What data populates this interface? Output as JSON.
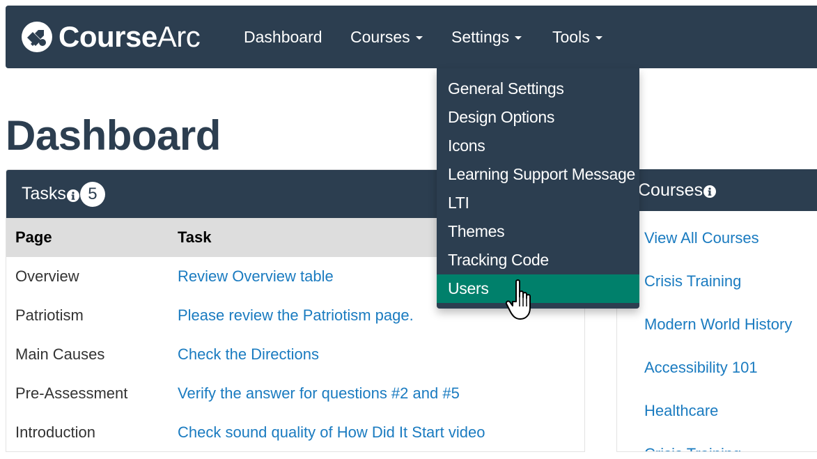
{
  "brand": {
    "bold": "Course",
    "light": "Arc"
  },
  "nav": {
    "dashboard": "Dashboard",
    "courses": "Courses",
    "settings": "Settings",
    "tools": "Tools"
  },
  "settings_menu": {
    "items": [
      {
        "label": "General Settings",
        "active": false
      },
      {
        "label": "Design Options",
        "active": false
      },
      {
        "label": "Icons",
        "active": false
      },
      {
        "label": "Learning Support Message",
        "active": false
      },
      {
        "label": "LTI",
        "active": false
      },
      {
        "label": "Themes",
        "active": false
      },
      {
        "label": "Tracking Code",
        "active": false
      },
      {
        "label": "Users",
        "active": true
      }
    ]
  },
  "page_title": "Dashboard",
  "tasks": {
    "title": "Tasks",
    "count": "5",
    "columns": [
      "Page",
      "Task"
    ],
    "rows": [
      {
        "page": "Overview",
        "task": "Review Overview table"
      },
      {
        "page": "Patriotism",
        "task": "Please review the Patriotism page."
      },
      {
        "page": "Main Causes",
        "task": "Check the Directions"
      },
      {
        "page": "Pre-Assessment",
        "task": "Verify the answer for questions #2 and #5"
      },
      {
        "page": "Introduction",
        "task": "Check sound quality of How Did It Start video"
      }
    ]
  },
  "courses": {
    "title": "Courses",
    "links": [
      "View All Courses",
      "Crisis Training",
      "Modern World History",
      "Accessibility 101",
      "Healthcare",
      "Crisis Training"
    ]
  },
  "colors": {
    "navbar": "#2c3e50",
    "active_item": "#00806b",
    "link": "#1a7bc0",
    "table_header": "#dddddd"
  }
}
